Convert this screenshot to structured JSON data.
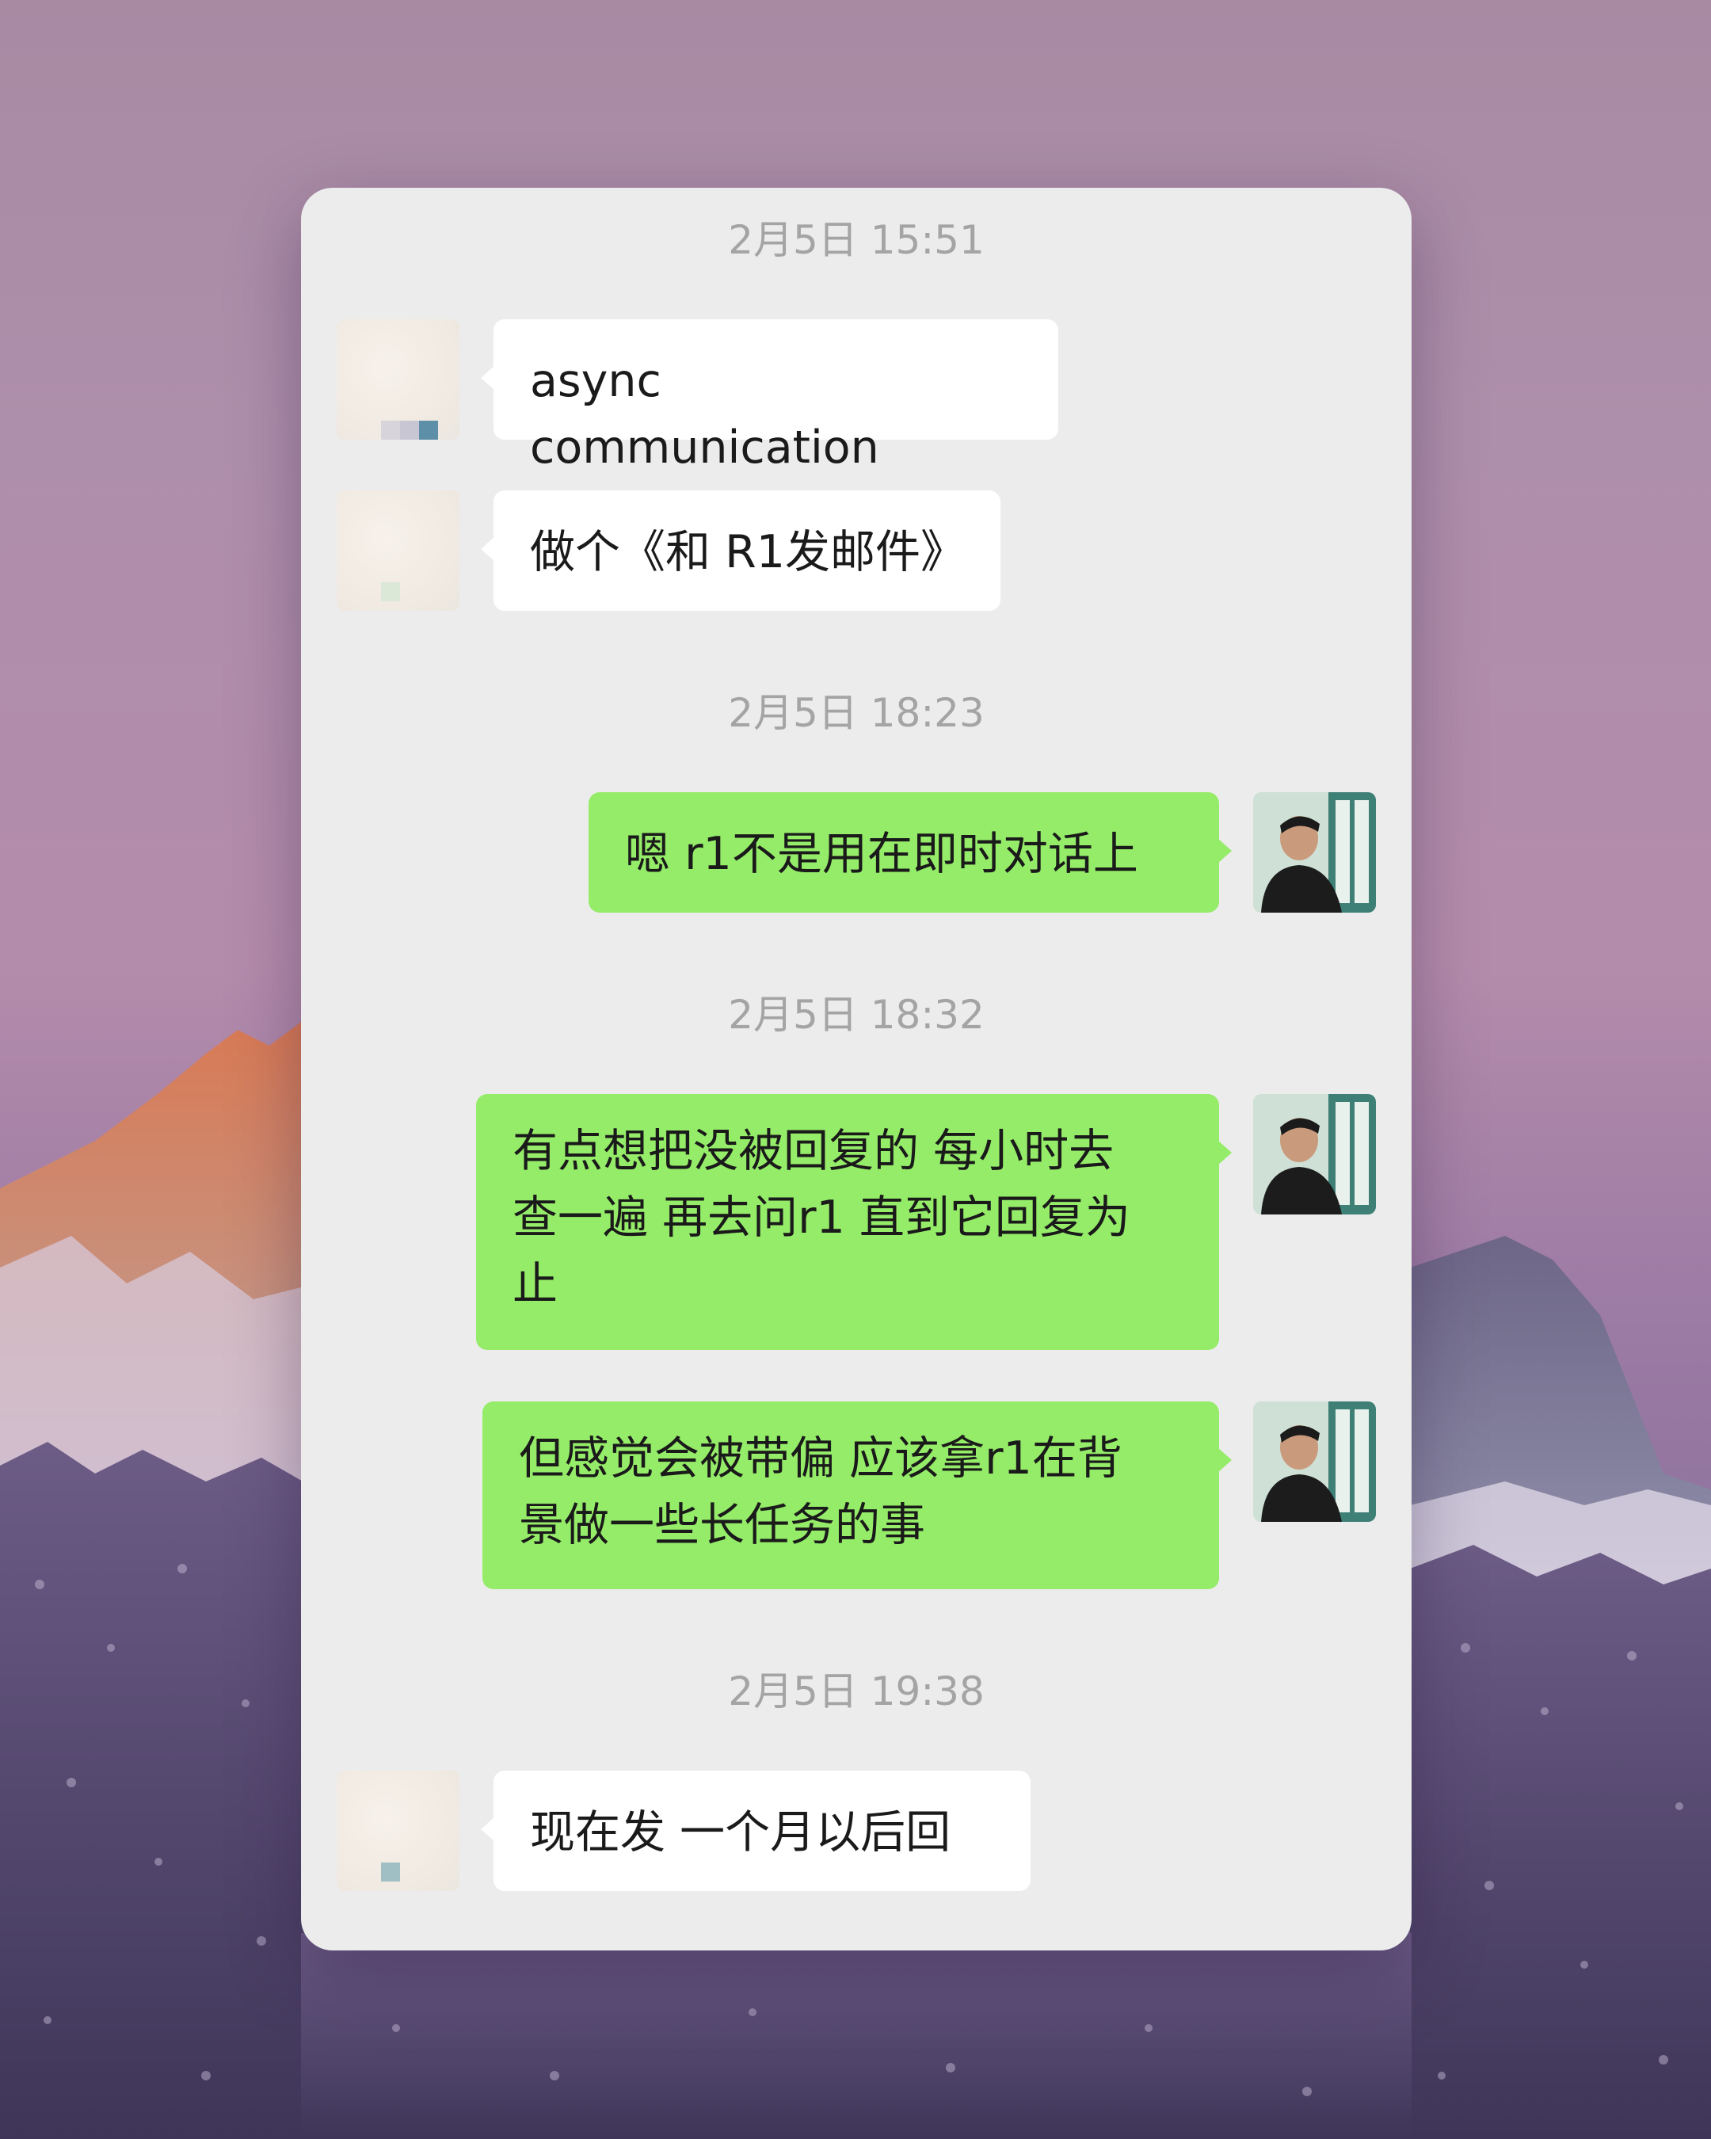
{
  "messages": [
    {
      "type": "timestamp",
      "text": "2月5日 15:51"
    },
    {
      "type": "message",
      "side": "left",
      "text": "async communication"
    },
    {
      "type": "message",
      "side": "left",
      "text": "做个《和 R1发邮件》"
    },
    {
      "type": "timestamp",
      "text": "2月5日 18:23"
    },
    {
      "type": "message",
      "side": "right",
      "text": "嗯 r1不是用在即时对话上"
    },
    {
      "type": "timestamp",
      "text": "2月5日 18:32"
    },
    {
      "type": "message",
      "side": "right",
      "text": "有点想把没被回复的 每小时去\n查一遍 再去问r1 直到它回复为\n止"
    },
    {
      "type": "message",
      "side": "right",
      "text": "但感觉会被带偏 应该拿r1在背\n景做一些长任务的事"
    },
    {
      "type": "timestamp",
      "text": "2月5日 19:38"
    },
    {
      "type": "message",
      "side": "left",
      "text": "现在发 一个月以后回"
    }
  ],
  "colors": {
    "panel_background": "#ececec",
    "sent_bubble": "#95ec69",
    "received_bubble": "#ffffff",
    "timestamp_text": "#a4a4a4"
  },
  "icons": {
    "contact_avatar": "blurred-avatar",
    "user_avatar": "person-photo-avatar"
  }
}
